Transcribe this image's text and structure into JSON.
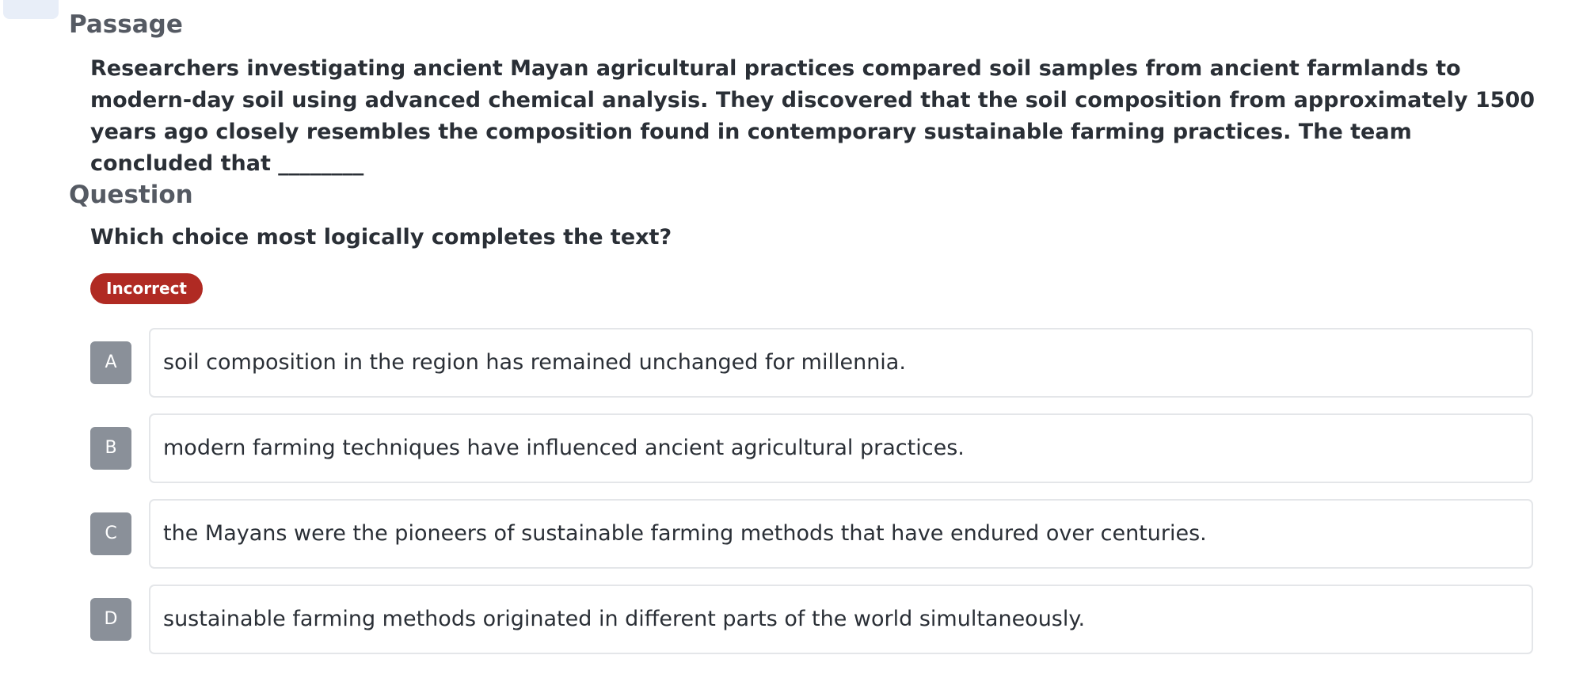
{
  "passage": {
    "title": "Passage",
    "text": "Researchers investigating ancient Mayan agricultural practices compared soil samples from ancient farmlands to modern-day soil using advanced chemical analysis. They discovered that the soil composition from approximately 1500 years ago closely resembles the composition found in contemporary sustainable farming practices. The team concluded that ________"
  },
  "question": {
    "title": "Question",
    "prompt": "Which choice most logically completes the text?",
    "status": "Incorrect",
    "status_color": "#b02a23"
  },
  "choices": [
    {
      "letter": "A",
      "text": "soil composition in the region has remained unchanged for millennia."
    },
    {
      "letter": "B",
      "text": "modern farming techniques have influenced ancient agricultural practices."
    },
    {
      "letter": "C",
      "text": "the Mayans were the pioneers of sustainable farming methods that have endured over centuries."
    },
    {
      "letter": "D",
      "text": "sustainable farming methods originated in different parts of the world simultaneously."
    }
  ]
}
